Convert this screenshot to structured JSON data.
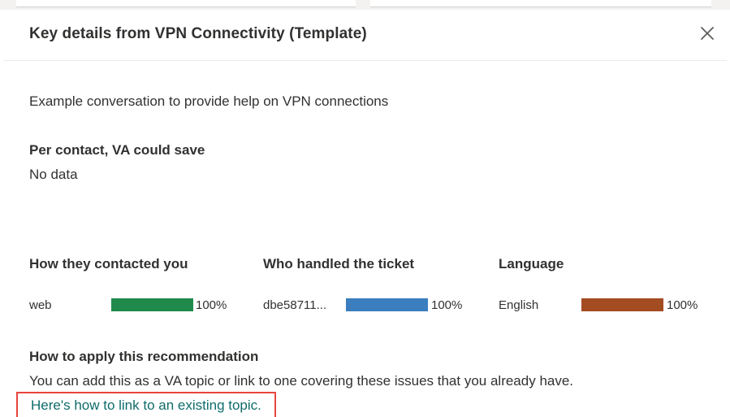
{
  "dialog": {
    "title": "Key details from VPN Connectivity (Template)",
    "close_icon": "close-icon"
  },
  "description": "Example conversation to provide help on VPN connections",
  "savings": {
    "label": "Per contact, VA could save",
    "value": "No data"
  },
  "stats": [
    {
      "heading": "How they contacted you",
      "item": "web",
      "percent_label": "100%",
      "percent": 100,
      "color": "#1f8a4c"
    },
    {
      "heading": "Who handled the ticket",
      "item": "dbe58711...",
      "percent_label": "100%",
      "percent": 100,
      "color": "#3a7ebf"
    },
    {
      "heading": "Language",
      "item": "English",
      "percent_label": "100%",
      "percent": 100,
      "color": "#a34c22"
    }
  ],
  "recommendation": {
    "heading": "How to apply this recommendation",
    "body": "You can add this as a VA topic or link to one covering these issues that you already have.",
    "link_text": "Here's how to link to an existing topic."
  },
  "colors": {
    "link": "#0f6c6b",
    "highlight_border": "#e8453c"
  }
}
